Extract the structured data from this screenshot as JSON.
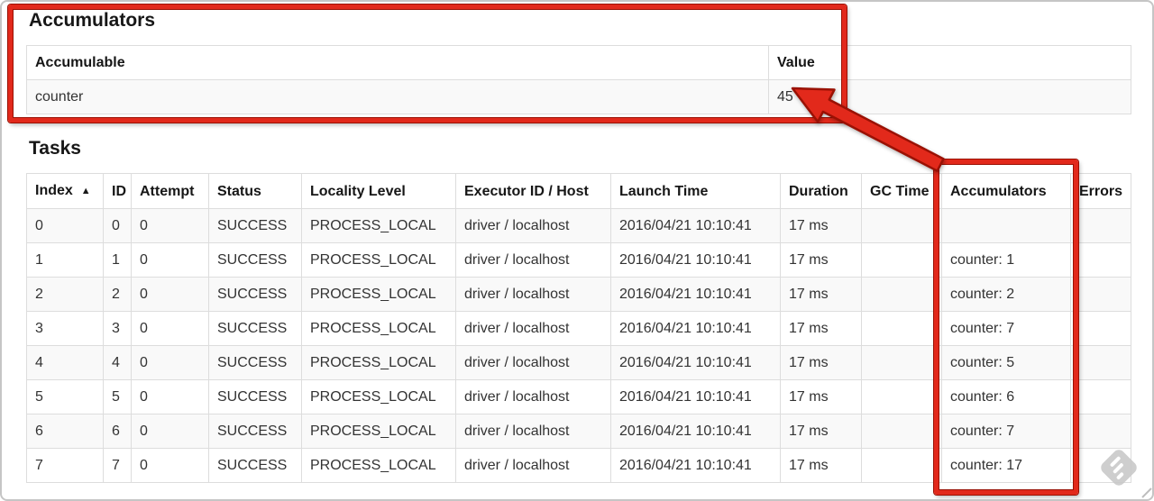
{
  "accumulators": {
    "heading": "Accumulators",
    "columns": [
      "Accumulable",
      "Value"
    ],
    "rows": [
      {
        "accumulable": "counter",
        "value": "45"
      }
    ]
  },
  "tasks": {
    "heading": "Tasks",
    "sort_icon": "▲",
    "columns": [
      {
        "label": "Index",
        "sorted": true
      },
      {
        "label": "ID"
      },
      {
        "label": "Attempt"
      },
      {
        "label": "Status"
      },
      {
        "label": "Locality Level"
      },
      {
        "label": "Executor ID / Host"
      },
      {
        "label": "Launch Time"
      },
      {
        "label": "Duration"
      },
      {
        "label": "GC Time"
      },
      {
        "label": "Accumulators"
      },
      {
        "label": "Errors"
      }
    ],
    "rows": [
      [
        "0",
        "0",
        "0",
        "SUCCESS",
        "PROCESS_LOCAL",
        "driver / localhost",
        "2016/04/21 10:10:41",
        "17 ms",
        "",
        "",
        ""
      ],
      [
        "1",
        "1",
        "0",
        "SUCCESS",
        "PROCESS_LOCAL",
        "driver / localhost",
        "2016/04/21 10:10:41",
        "17 ms",
        "",
        "counter: 1",
        ""
      ],
      [
        "2",
        "2",
        "0",
        "SUCCESS",
        "PROCESS_LOCAL",
        "driver / localhost",
        "2016/04/21 10:10:41",
        "17 ms",
        "",
        "counter: 2",
        ""
      ],
      [
        "3",
        "3",
        "0",
        "SUCCESS",
        "PROCESS_LOCAL",
        "driver / localhost",
        "2016/04/21 10:10:41",
        "17 ms",
        "",
        "counter: 7",
        ""
      ],
      [
        "4",
        "4",
        "0",
        "SUCCESS",
        "PROCESS_LOCAL",
        "driver / localhost",
        "2016/04/21 10:10:41",
        "17 ms",
        "",
        "counter: 5",
        ""
      ],
      [
        "5",
        "5",
        "0",
        "SUCCESS",
        "PROCESS_LOCAL",
        "driver / localhost",
        "2016/04/21 10:10:41",
        "17 ms",
        "",
        "counter: 6",
        ""
      ],
      [
        "6",
        "6",
        "0",
        "SUCCESS",
        "PROCESS_LOCAL",
        "driver / localhost",
        "2016/04/21 10:10:41",
        "17 ms",
        "",
        "counter: 7",
        ""
      ],
      [
        "7",
        "7",
        "0",
        "SUCCESS",
        "PROCESS_LOCAL",
        "driver / localhost",
        "2016/04/21 10:10:41",
        "17 ms",
        "",
        "counter: 17",
        ""
      ]
    ]
  },
  "annotations": {
    "highlight_color": "#e2291b",
    "outline_color": "#9a1104"
  }
}
